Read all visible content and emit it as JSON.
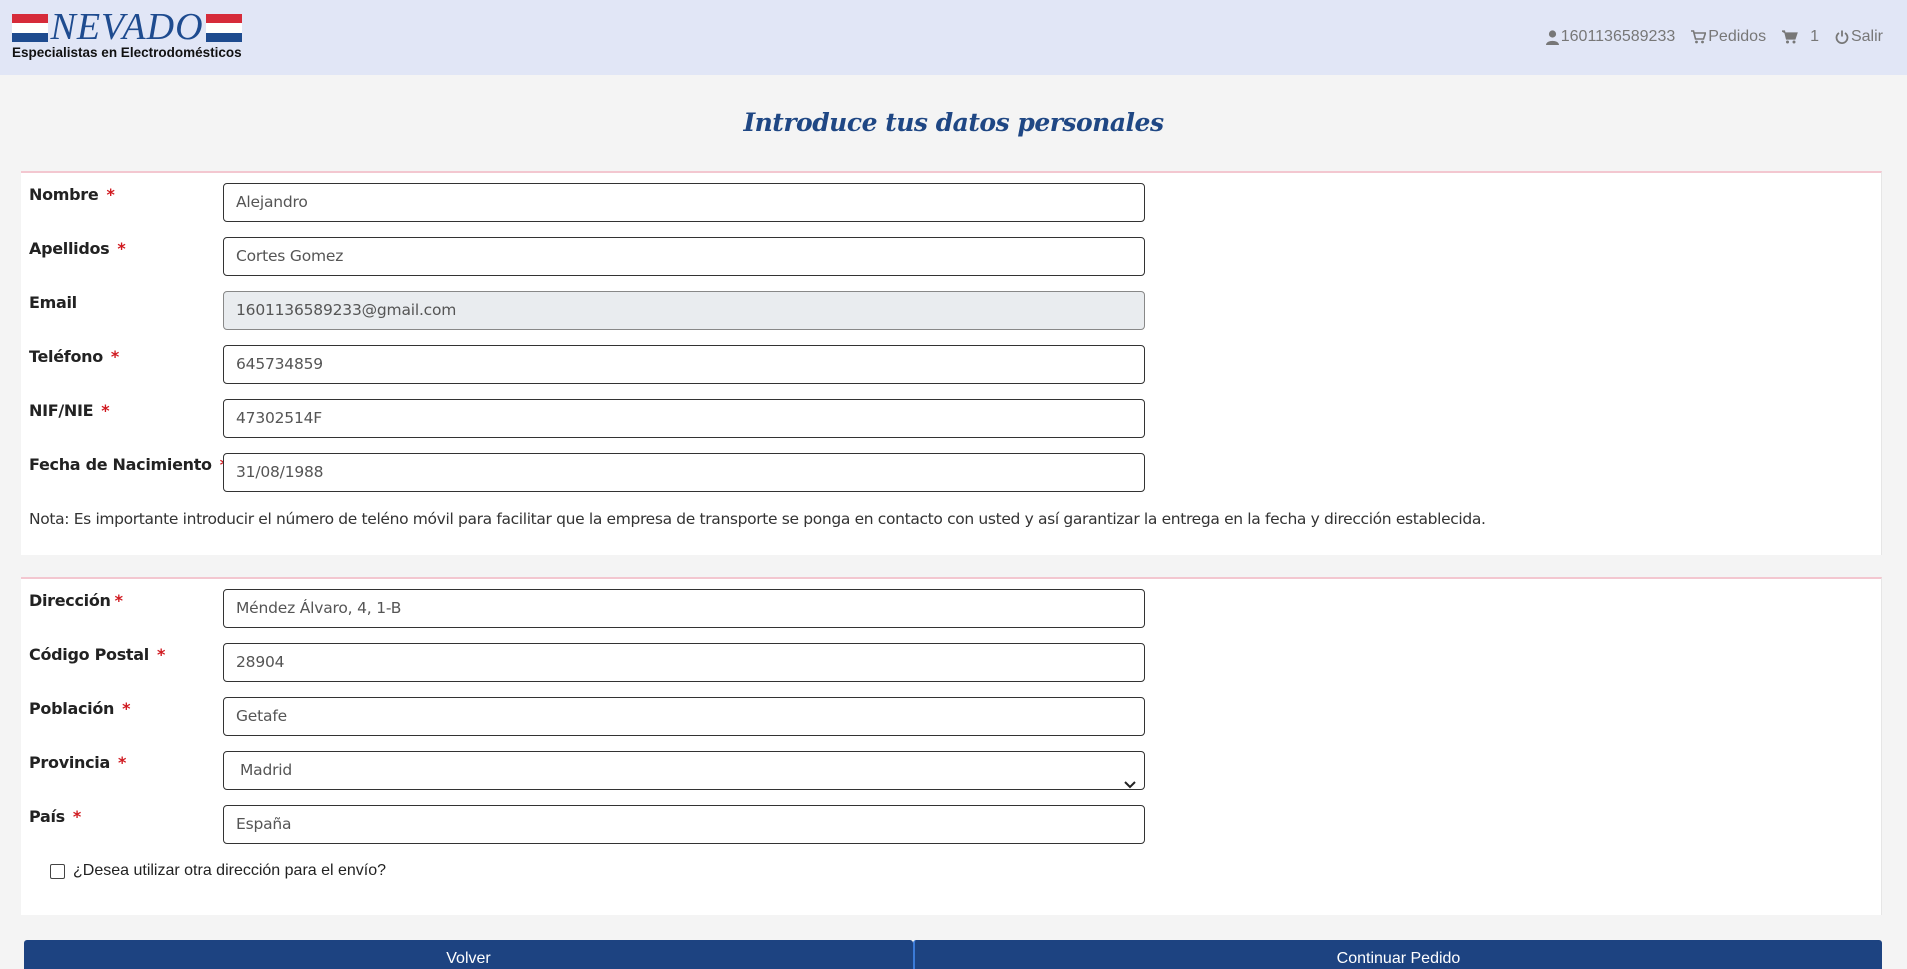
{
  "header": {
    "logo_text": "NEVADO",
    "tagline": "Especialistas en Electrodomésticos",
    "flag_colors": [
      "#d62b3a",
      "#ffffff",
      "#1e4b8f"
    ],
    "user_label": "1601136589233",
    "orders_label": "Pedidos",
    "cart_count": "1",
    "logout_label": "Salir"
  },
  "page": {
    "title": "Introduce tus datos personales"
  },
  "personal": {
    "nombre": {
      "label": "Nombre",
      "required": "*",
      "value": "Alejandro"
    },
    "apellidos": {
      "label": "Apellidos",
      "required": "*",
      "value": "Cortes Gomez"
    },
    "email": {
      "label": "Email",
      "value": "1601136589233@gmail.com"
    },
    "telefono": {
      "label": "Teléfono",
      "required": "*",
      "value": "645734859"
    },
    "nif": {
      "label": "NIF/NIE",
      "required": "*",
      "value": "47302514F"
    },
    "fecha": {
      "label": "Fecha de Nacimiento",
      "required": "*",
      "value": "31/08/1988"
    },
    "nota": "Nota: Es importante introducir el número de teléno móvil para facilitar que la empresa de transporte se ponga en contacto con usted y así garantizar la entrega en la fecha y dirección establecida."
  },
  "address": {
    "direccion": {
      "label": "Dirección",
      "required": "*",
      "value": "Méndez Álvaro, 4, 1-B"
    },
    "cp": {
      "label": "Código Postal",
      "required": "*",
      "value": "28904"
    },
    "poblacion": {
      "label": "Población",
      "required": "*",
      "value": "Getafe"
    },
    "provincia": {
      "label": "Provincia",
      "required": "*",
      "value": "Madrid"
    },
    "pais": {
      "label": "País",
      "required": "*",
      "value": "España"
    },
    "otra_direccion": {
      "label": "¿Desea utilizar otra dirección para el envío?",
      "checked": false
    }
  },
  "actions": {
    "back_label": "Volver",
    "continue_label": "Continuar Pedido"
  },
  "colors": {
    "header_bg": "#e1e6f6",
    "primary": "#1d4381",
    "title": "#1f4784",
    "required": "#d0191f",
    "panel_border": "#f3c7d0"
  }
}
